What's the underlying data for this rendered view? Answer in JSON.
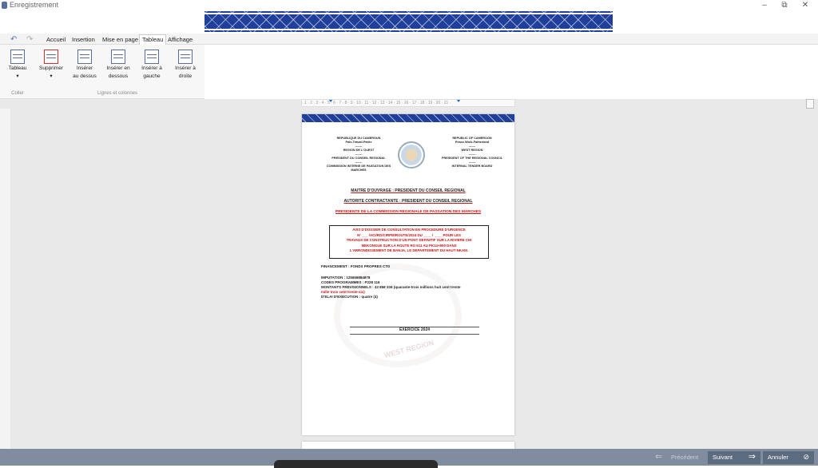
{
  "window": {
    "title": "Enregistrement",
    "controls": [
      "–",
      "⧉",
      "✕"
    ]
  },
  "ribbon_tabs": [
    "Accueil",
    "Insertion",
    "Mise en page",
    "Tableau",
    "Affichage"
  ],
  "active_tab": "Tableau",
  "ribbon_buttons": [
    {
      "label": "Tableau",
      "sub": "▾",
      "icon": "table-icon"
    },
    {
      "label": "Supprimer",
      "sub": "▾",
      "icon": "delete-table-icon"
    },
    {
      "label": "Insérer",
      "sub": "au dessus",
      "icon": "insert-above-icon"
    },
    {
      "label": "Insérer en",
      "sub": "dessous",
      "icon": "insert-below-icon"
    },
    {
      "label": "Insérer à",
      "sub": "gauche",
      "icon": "insert-left-icon"
    },
    {
      "label": "Insérer à",
      "sub": "droite",
      "icon": "insert-right-icon"
    }
  ],
  "ribbon_groups": [
    "Coller",
    "Lignes et colonnes"
  ],
  "ruler_text": "· 1 · 2 · 3 · 4 · 5 · 6 · 7 · 8 · 9 · 10 · 11 · 12 · 13 · 14 · 15 · 16 · 17 · 18 · 19 · 20 · 21 ·",
  "document": {
    "left_header": [
      "REPUBLIQUE DU CAMEROUN",
      "Paix-Travail-Patrie",
      "-------",
      "REGION DE L'OUEST",
      "-------",
      "PRESIDENT DU CONSEIL REGIONAL",
      "-------",
      "COMMISSION INTERNE DE PASSATION DES MARCHES"
    ],
    "right_header": [
      "REPUBLIC OF CAMEROON",
      "Peace-Work-Fatherland",
      "-------",
      "WEST REGION",
      "-------",
      "PRESIDENT OF THE REGIONAL COUNCIL",
      "-------",
      "INTERNAL TENDER BOARD"
    ],
    "maitre": "MAITRE D'OUVRAGE : PRESIDENT DU CONSEIL REGIONAL",
    "autorite": "AUTORITE CONTRACTANTE : PRESIDENT DU CONSEIL REGIONAL",
    "presidente": "PRESIDENTE DE LA COMMISSION REGIONALE DE PASSATION DES MARCHES",
    "avis": [
      "AVIS D'DOSSIER DE CONSULTATION EN PROCEDURE D'URGENCE",
      "N° ___ /ACI/RO/CIRPM/ROUTE/2024 DU ____ / ____ POUR LES",
      "TRAVAUX DE CONSTRUCTION D'UN PONT DEFINITIF SUR LA RIVIERE CHI",
      "MEKONGUE SUR LA ROUTE RO 611 AU PK14+800 DANS",
      "L'ARRONDISSEMENT DE BANJA, LE DEPARTEMENT DU HAUT-NKAM."
    ],
    "financement": "FINANCEMENT : FONDS PROPRES CTD",
    "imputation": "IMPUTATION : 125656884878",
    "codes": "CODES PROGRAMMES : P228 116",
    "montants": "MONTANTS PREVISIONNELS : 43 858 336 (quarante-trois millions huit cent trente",
    "montants2": "mille trois cent trente-six)",
    "delai": "D'ELAI D'EXECUTION : quatre (4)",
    "exercice": "EXERCICE 2024",
    "watermark": "WEST REGION"
  },
  "footer": {
    "prev": "Précédent",
    "next": "Suivant",
    "cancel": "Annuler"
  }
}
